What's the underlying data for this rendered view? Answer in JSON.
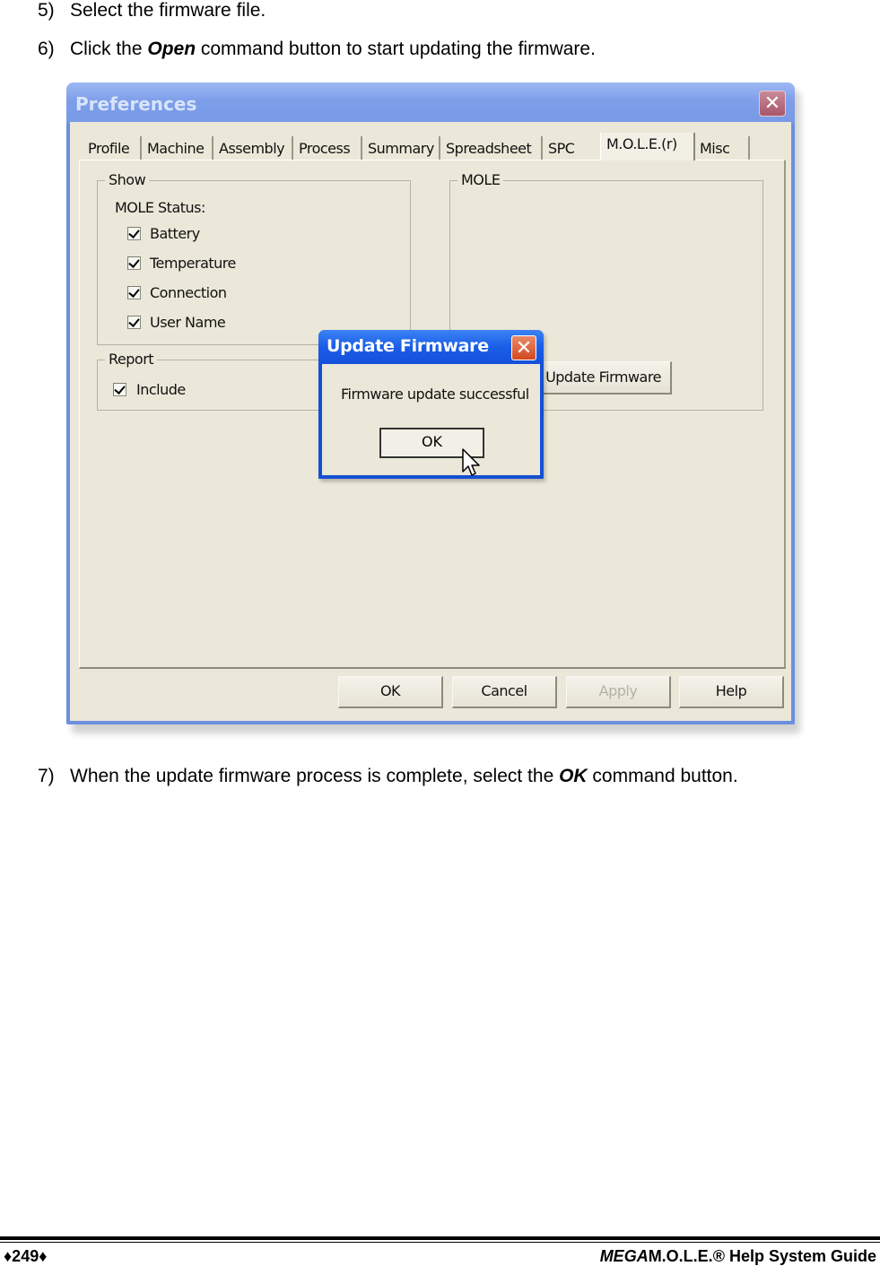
{
  "steps": [
    {
      "num": "5)",
      "text_before": "Select the firmware file.",
      "emphasis": "",
      "text_after": ""
    },
    {
      "num": "6)",
      "text_before": "Click the ",
      "emphasis": "Open",
      "text_after": " command button to start updating the firmware."
    },
    {
      "num": "7)",
      "text_before": "When the update firmware process is complete, select the ",
      "emphasis": "OK",
      "text_after": " command button."
    }
  ],
  "preferences_window": {
    "title": "Preferences",
    "close_icon": "close-x-icon",
    "tabs": [
      {
        "label": "Profile",
        "active": false
      },
      {
        "label": "Machine",
        "active": false
      },
      {
        "label": "Assembly",
        "active": false
      },
      {
        "label": "Process",
        "active": false
      },
      {
        "label": "Summary",
        "active": false
      },
      {
        "label": "Spreadsheet",
        "active": false
      },
      {
        "label": "SPC",
        "active": false
      },
      {
        "label": "M.O.L.E.(r)",
        "active": true
      },
      {
        "label": "Misc",
        "active": false
      }
    ],
    "show_group": {
      "label": "Show",
      "sublabel": "MOLE Status:",
      "checkboxes": [
        {
          "label": "Battery",
          "checked": true
        },
        {
          "label": "Temperature",
          "checked": true
        },
        {
          "label": "Connection",
          "checked": true
        },
        {
          "label": "User Name",
          "checked": true
        }
      ]
    },
    "report_group": {
      "label": "Report",
      "checkboxes": [
        {
          "label": "Include",
          "checked": true
        }
      ]
    },
    "mole_group": {
      "label": "MOLE",
      "update_button": "Update Firmware"
    },
    "buttons": {
      "ok": "OK",
      "cancel": "Cancel",
      "apply": "Apply",
      "help": "Help"
    }
  },
  "message_box": {
    "title": "Update Firmware",
    "message": "Firmware update successful",
    "ok_button": "OK",
    "close_icon": "close-x-icon"
  },
  "footer": {
    "page_number": "♦249♦",
    "guide_title_italic": "MEGA",
    "guide_title_rest": "M.O.L.E.® Help System Guide"
  },
  "colors": {
    "xp_title_blue": "#1a5ee6",
    "inactive_title_blue": "#7d9ee9",
    "dialog_face": "#ebe8d9",
    "close_red": "#d04820"
  }
}
